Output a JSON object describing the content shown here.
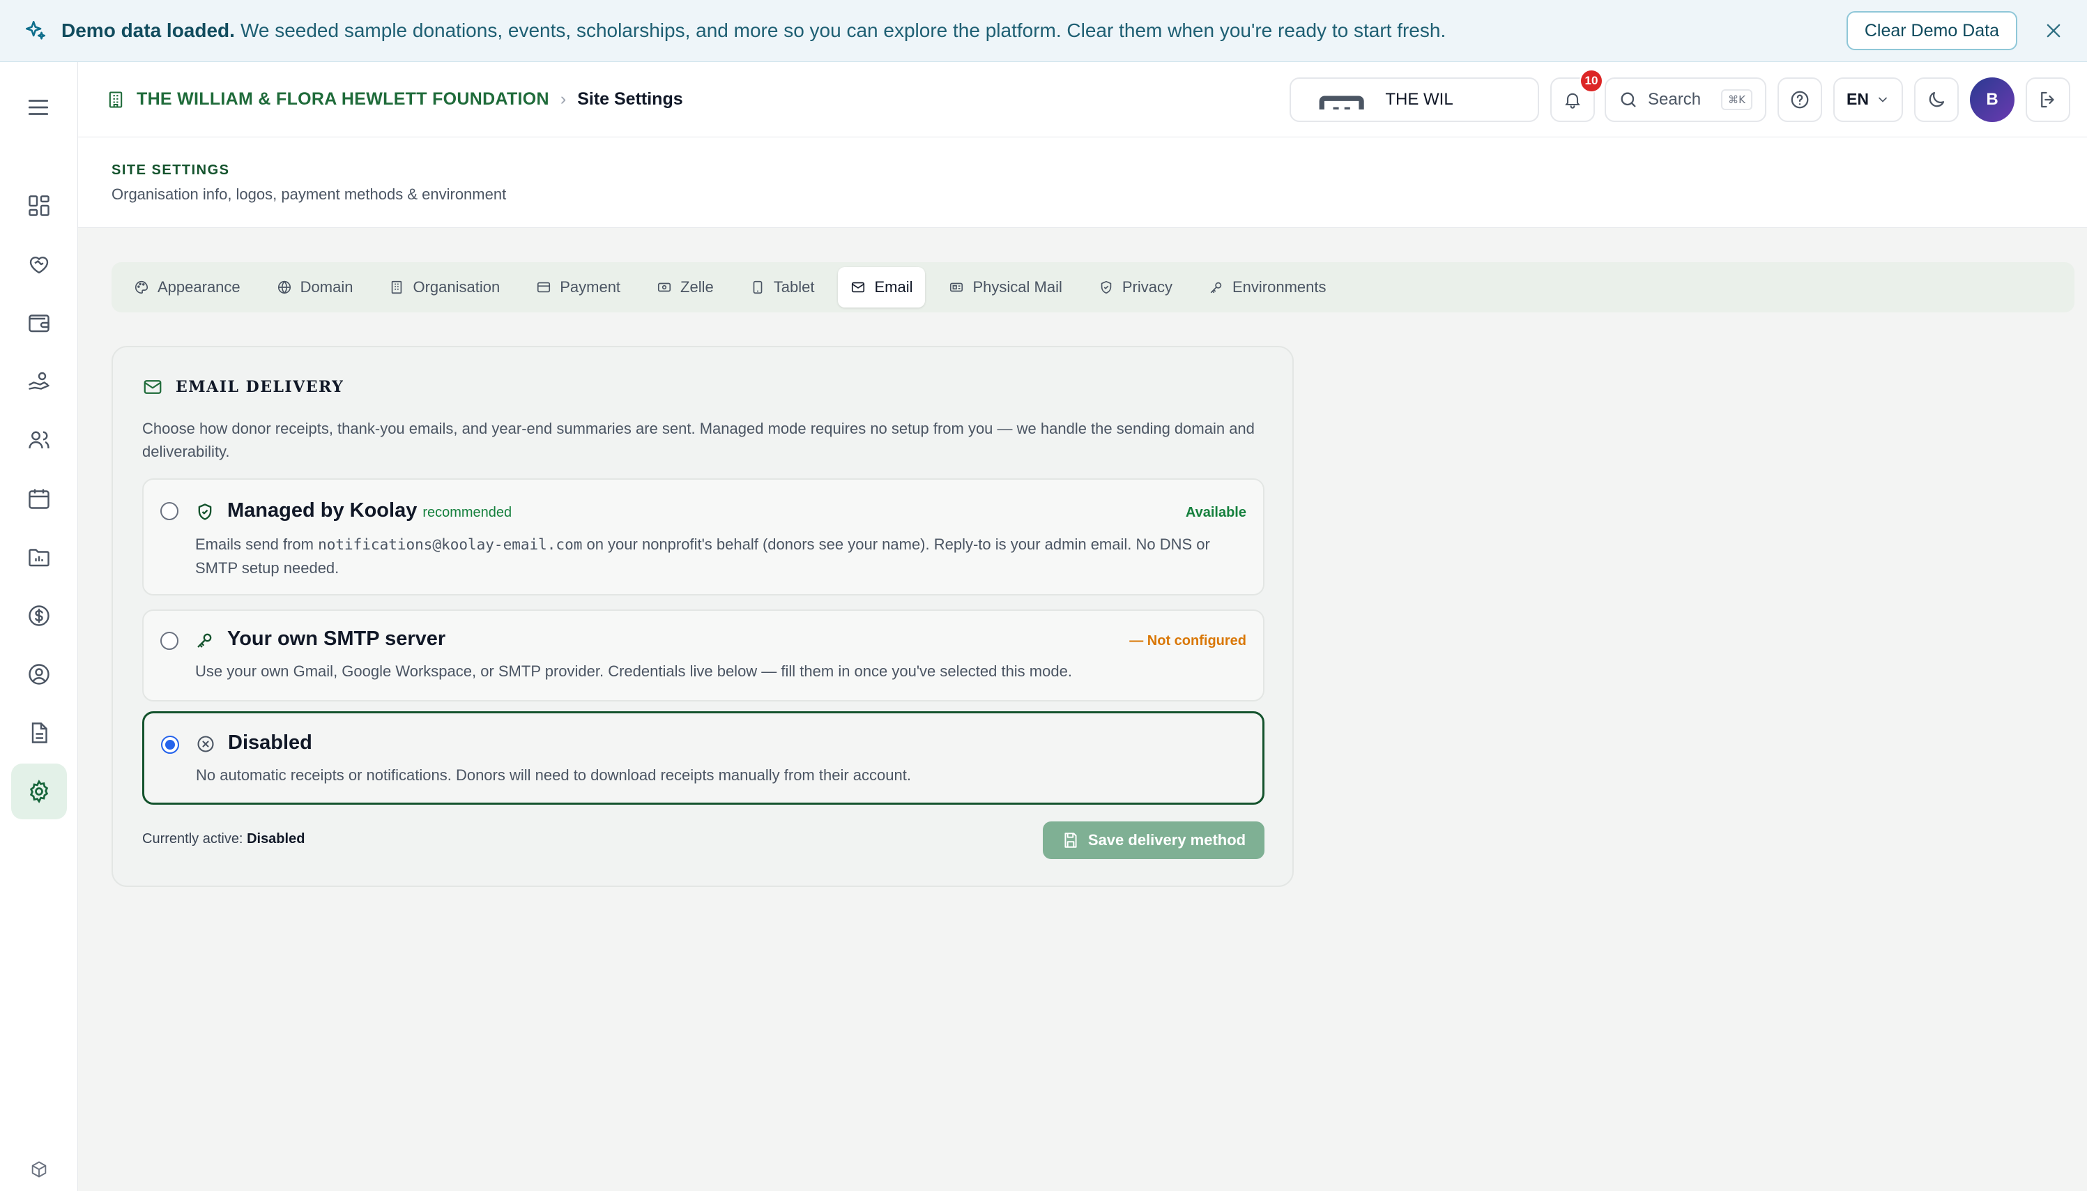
{
  "banner": {
    "title": "Demo data loaded.",
    "message": "We seeded sample donations, events, scholarships, and more so you can explore the platform. Clear them when you're ready to start fresh.",
    "clear_button": "Clear Demo Data",
    "icon": "sparkles-icon"
  },
  "breadcrumb": {
    "org": "THE WILLIAM & FLORA HEWLETT FOUNDATION",
    "separator": "›",
    "page": "Site Settings"
  },
  "topbar": {
    "org_selector": "THE WILLIAM & FL...",
    "notifications_count": "10",
    "search_label": "Search",
    "search_shortcut": "⌘K",
    "language": "EN",
    "avatar_initial": "B"
  },
  "page": {
    "title": "SITE SETTINGS",
    "subtitle": "Organisation info, logos, payment methods & environment"
  },
  "tabs": [
    {
      "label": "Appearance",
      "icon": "palette-icon"
    },
    {
      "label": "Domain",
      "icon": "globe-icon"
    },
    {
      "label": "Organisation",
      "icon": "building-icon"
    },
    {
      "label": "Payment",
      "icon": "credit-card-icon"
    },
    {
      "label": "Zelle",
      "icon": "banknote-icon"
    },
    {
      "label": "Tablet",
      "icon": "tablet-icon"
    },
    {
      "label": "Email",
      "icon": "mail-icon",
      "active": true
    },
    {
      "label": "Physical Mail",
      "icon": "postage-icon"
    },
    {
      "label": "Privacy",
      "icon": "shield-icon"
    },
    {
      "label": "Environments",
      "icon": "key-icon"
    }
  ],
  "email_delivery": {
    "title": "EMAIL DELIVERY",
    "description": "Choose how donor receipts, thank-you emails, and year-end summaries are sent. Managed mode requires no setup from you — we handle the sending domain and deliverability.",
    "options": [
      {
        "title": "Managed by Koolay",
        "badge": "recommended",
        "status": "Available",
        "desc_prefix": "Emails send from ",
        "desc_code": "notifications@koolay-email.com",
        "desc_suffix": " on your nonprofit's behalf (donors see your name). Reply-to is your admin email. No DNS or SMTP setup needed.",
        "selected": false
      },
      {
        "title": "Your own SMTP server",
        "status": "— Not configured",
        "description": "Use your own Gmail, Google Workspace, or SMTP provider. Credentials live below — fill them in once you've selected this mode.",
        "selected": false
      },
      {
        "title": "Disabled",
        "description": "No automatic receipts or notifications. Donors will need to download receipts manually from their account.",
        "selected": true
      }
    ],
    "currently_active_label": "Currently active:",
    "currently_active_value": "Disabled",
    "save_button": "Save delivery method"
  },
  "colors": {
    "brand_green": "#14532d",
    "available_green": "#15803d",
    "not_configured_orange": "#d97706",
    "radio_blue": "#2563eb",
    "badge_red": "#dc2626"
  }
}
